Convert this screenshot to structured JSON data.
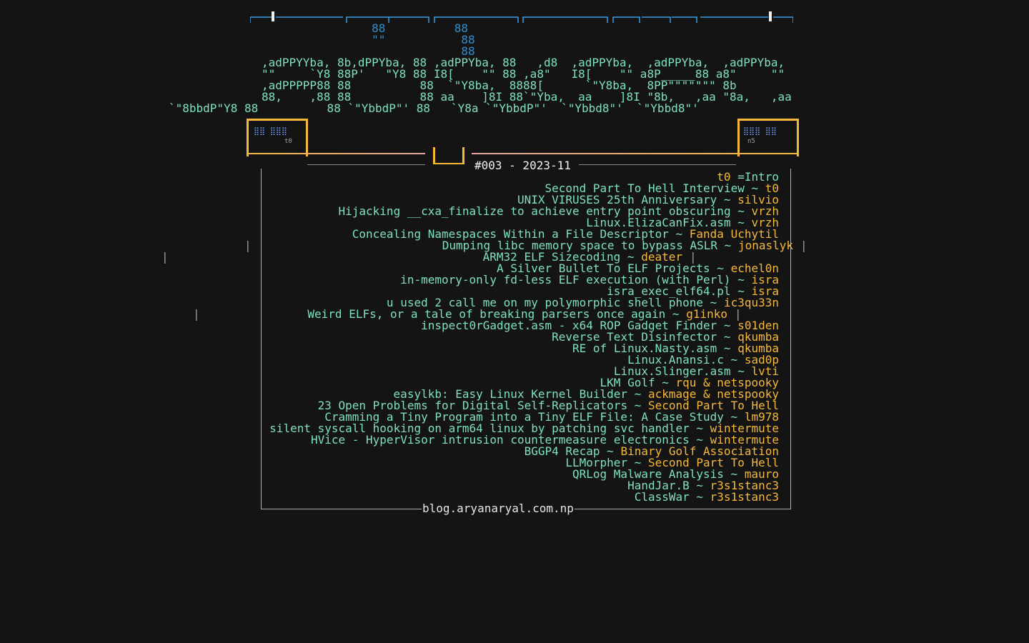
{
  "banner": {
    "lines": [
      "                88          88",
      "                \"\"           88",
      "                             88",
      ",adPPYYba, 8b,dPPYba, 88 ,adPPYba, 88   ,d8  ,adPPYba,  ,adPPYba,  ,adPPYba,",
      "\"\"     `Y8 88P'   \"Y8 88 I8[    \"\" 88 ,a8\"   I8[    \"\" a8P_____88 a8\"     \"\"",
      ",adPPPPP88 88          88  `\"Y8ba,  8888[      `\"Y8ba,  8PP\"\"\"\"\"\"\" 8b",
      "88,    ,88 88          88 aa    ]8I 88`\"Yba,  aa    ]8I \"8b,   ,aa \"8a,   ,aa",
      "`\"8bbdP\"Y8 88          88 `\"YbbdP\"' 88   `Y8a `\"YbbdP\"'  `\"Ybbd8\"'  `\"Ybbd8\"'"
    ]
  },
  "header": {
    "issue": "#003 - 2023-11",
    "left_tag": "t0",
    "right_tag": "n5"
  },
  "toc": {
    "items": [
      {
        "title": "=Intro",
        "author": "t0 ",
        "author_first": true
      },
      {
        "title": "Second Part To Hell Interview ~ ",
        "author": "t0"
      },
      {
        "title": "UNIX VIRUSES 25th Anniversary ~ ",
        "author": "silvio"
      },
      {
        "title": "Hijacking __cxa_finalize to achieve entry point obscuring ~ ",
        "author": "vrzh"
      },
      {
        "title": "Linux.ElizaCanFix.asm ~ ",
        "author": "vrzh"
      },
      {
        "title": "Concealing Namespaces Within a File Descriptor ~ ",
        "author": "Fanda Uchytil"
      },
      {
        "title": "Dumping libc memory space to bypass ASLR ~ ",
        "author": "jonaslyk"
      },
      {
        "title": "ARM32 ELF Sizecoding ~ ",
        "author": "deater"
      },
      {
        "title": "A Silver Bullet To ELF Projects ~ ",
        "author": "echel0n"
      },
      {
        "title": "in-memory-only fd-less ELF execution (with Perl) ~ ",
        "author": "isra"
      },
      {
        "title": "isra_exec_elf64.pl ~ ",
        "author": "isra"
      },
      {
        "title": "u used 2 call me on my polymorphic shell phone ~ ",
        "author": "ic3qu33n"
      },
      {
        "title": "Weird ELFs, or a tale of breaking parsers once again ~ ",
        "author": "g1inko"
      },
      {
        "title": "inspect0rGadget.asm - x64 ROP Gadget Finder ~ ",
        "author": "s01den"
      },
      {
        "title": "Reverse Text Disinfector ~ ",
        "author": "qkumba"
      },
      {
        "title": "RE of Linux.Nasty.asm ~ ",
        "author": "qkumba"
      },
      {
        "title": "Linux.Anansi.c ~ ",
        "author": "sad0p"
      },
      {
        "title": "Linux.Slinger.asm ~ ",
        "author": "lvti"
      },
      {
        "title": "LKM Golf ~ ",
        "author": "rqu & netspooky"
      },
      {
        "title": "easylkb: Easy Linux Kernel Builder ~ ",
        "author": "ackmage & netspooky"
      },
      {
        "title": "23 Open Problems for Digital Self-Replicators ~ ",
        "author": "Second Part To Hell"
      },
      {
        "title": "Cramming a Tiny Program into a Tiny ELF File: A Case Study ~ ",
        "author": "lm978"
      },
      {
        "title": "silent syscall hooking on arm64 linux by patching svc handler ~ ",
        "author": "wintermute"
      },
      {
        "title": "HVice - HyperVisor intrusion countermeasure electronics ~ ",
        "author": "wintermute"
      },
      {
        "title": "BGGP4 Recap ~ ",
        "author": "Binary Golf Association"
      },
      {
        "title": "LLMorpher ~ ",
        "author": "Second Part To Hell"
      },
      {
        "title": "QRLog Malware Analysis ~ ",
        "author": "mauro"
      },
      {
        "title": "HandJar.B ~ ",
        "author": "r3s1stanc3"
      },
      {
        "title": "ClassWar ~ ",
        "author": "r3s1stanc3"
      }
    ]
  },
  "footer": {
    "link": "blog.aryanaryal.com.np"
  },
  "colors": {
    "background": "#141414",
    "teal": "#7fe0c4",
    "gold": "#f5b83b",
    "blue": "#2f8fd0"
  }
}
